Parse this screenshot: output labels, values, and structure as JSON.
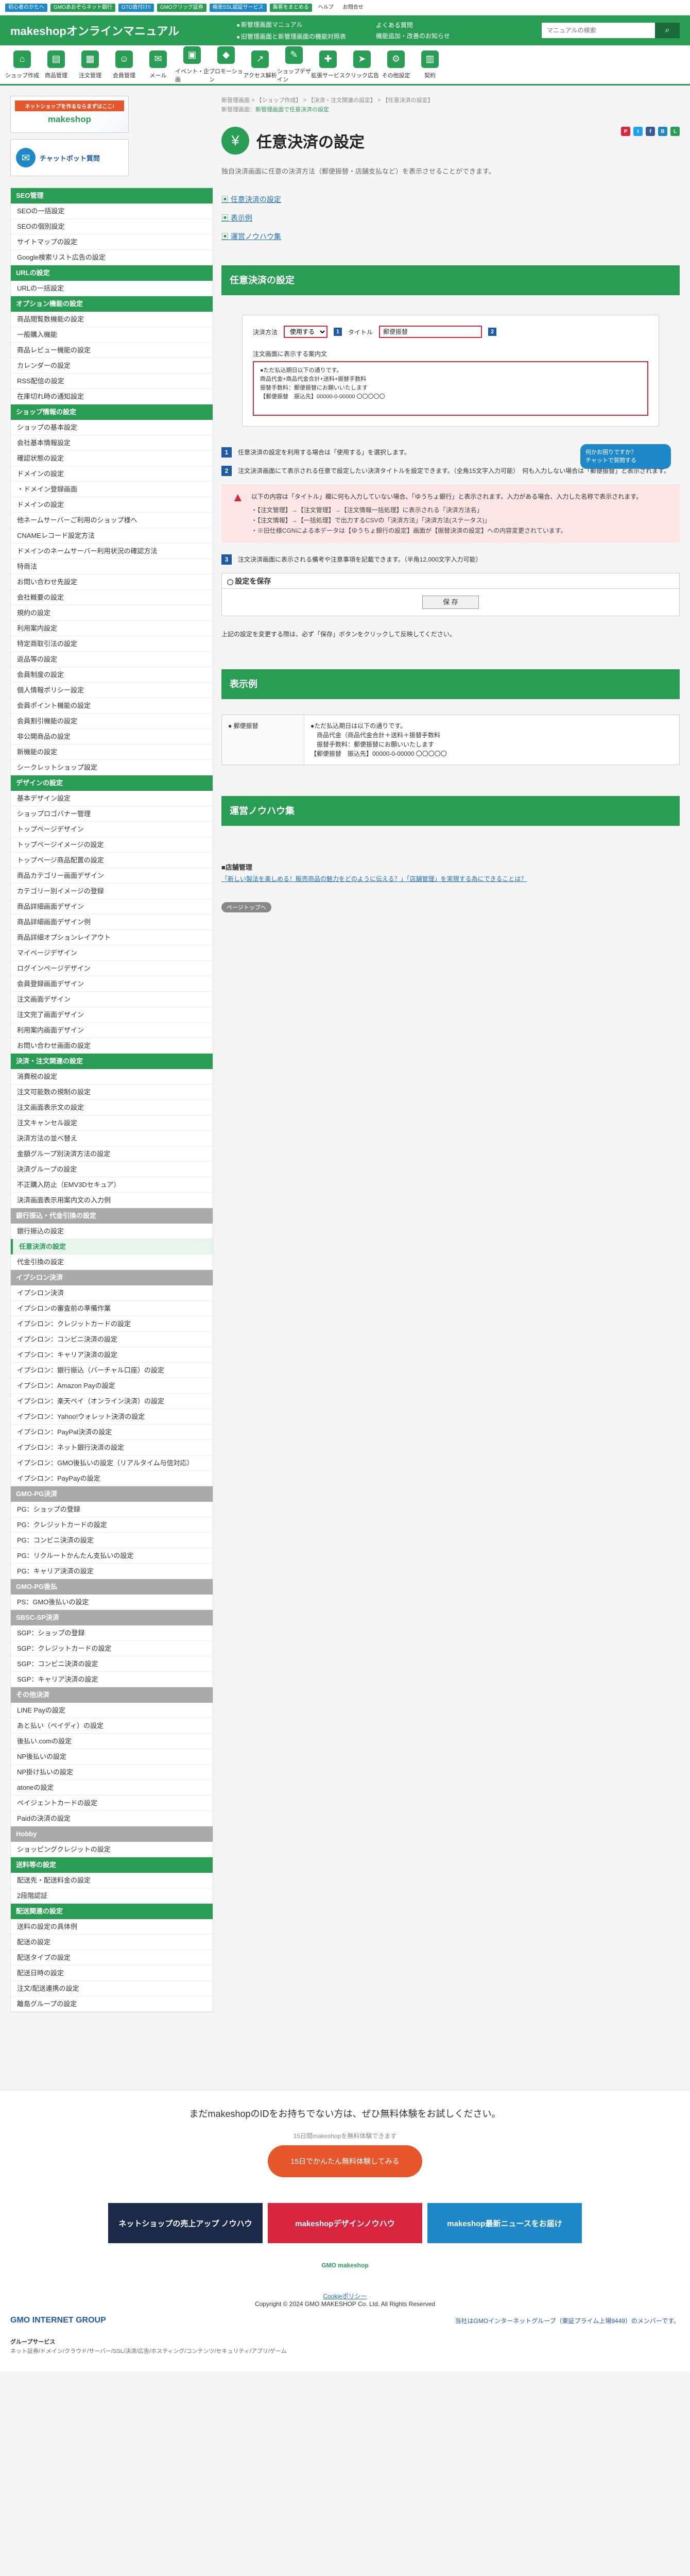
{
  "topbar": {
    "links": [
      "初心者のかたへ",
      "GMOあおぞらネット銀行",
      "GTO直付け!!",
      "GMOクリック証券",
      "格安SSL認証サービス",
      "集客をまとめる",
      "ヘルプ",
      "お問合せ"
    ]
  },
  "header": {
    "logo": "makeshopオンラインマニュアル",
    "links": [
      "新管理画面マニュアル",
      "旧管理画面と新管理画面の機能対照表"
    ],
    "faq_label": "よくある質問",
    "news_label": "機能追加・改善のお知らせ",
    "search_placeholder": "マニュアルの検索"
  },
  "nav": {
    "items": [
      {
        "label": "ショップ作成",
        "icon": "shop-icon"
      },
      {
        "label": "商品管理",
        "icon": "box-icon"
      },
      {
        "label": "注文管理",
        "icon": "clipboard-icon"
      },
      {
        "label": "会員管理",
        "icon": "users-icon"
      },
      {
        "label": "メール",
        "icon": "mail-icon"
      },
      {
        "label": "イベント・企画",
        "icon": "calendar-icon"
      },
      {
        "label": "プロモーション",
        "icon": "megaphone-icon"
      },
      {
        "label": "アクセス解析",
        "icon": "chart-icon"
      },
      {
        "label": "ショップデザイン",
        "icon": "palette-icon"
      },
      {
        "label": "拡張サービス",
        "icon": "puzzle-icon"
      },
      {
        "label": "クリック広告",
        "icon": "cursor-icon"
      },
      {
        "label": "その他設定",
        "icon": "gear-icon"
      },
      {
        "label": "契約",
        "icon": "document-icon"
      }
    ]
  },
  "banners": {
    "b1_top": "ネットショップを作るならまずはここ!",
    "b1_brand": "makeshop",
    "b2": "チャットボット質問"
  },
  "sidebar": {
    "groups": [
      {
        "title": "SEO管理",
        "items": [
          "SEOの一括設定",
          "SEOの個別設定",
          "サイトマップの設定",
          "Google検索リスト広告の設定"
        ]
      },
      {
        "title": "URLの設定",
        "items": [
          "URLの一括設定"
        ]
      },
      {
        "title": "オプション機能の設定",
        "items": [
          "商品閲覧数機能の設定",
          "一般購入機能",
          "商品レビュー機能の設定",
          "カレンダーの設定",
          "RSS配信の設定",
          "在庫切れ時の通知設定"
        ]
      },
      {
        "title": "ショップ情報の設定",
        "items": [
          "ショップの基本設定",
          "会社基本情報設定",
          "確認状態の設定",
          "ドメインの設定",
          "・ドメイン登録画面",
          "ドメインの設定",
          "他ネームサーバーご利用のショップ様へ",
          "CNAMEレコード設定方法",
          "ドメインのネームサーバー利用状況の確認方法",
          "特商法",
          "お問い合わせ先設定",
          "会社概要の設定",
          "規約の設定",
          "利用案内設定",
          "特定商取引法の設定",
          "返品等の設定",
          "会員制度の設定",
          "個人情報ポリシー設定",
          "会員ポイント機能の設定",
          "会員割引機能の設定",
          "非公開商品の設定",
          "新機能の設定",
          "シークレットショップ設定"
        ]
      },
      {
        "title": "デザインの設定",
        "items": [
          "基本デザイン設定",
          "ショップロゴバナー管理",
          "トップページデザイン",
          "トップページイメージの設定",
          "トップページ商品配置の設定",
          "商品カテゴリー画面デザイン",
          "カテゴリー別イメージの登録",
          "商品詳細画面デザイン",
          "商品詳細画面デザイン例",
          "商品詳細オプションレイアウト",
          "マイページデザイン",
          "ログインページデザイン",
          "会員登録画面デザイン",
          "注文画面デザイン",
          "注文完了画面デザイン",
          "利用案内画面デザイン",
          "お問い合わせ画面の設定"
        ]
      },
      {
        "title": "決済・注文関連の設定",
        "items": [
          "消費税の設定",
          "注文可能数の規制の設定",
          "注文画面表示文の設定",
          "注文キャンセル設定",
          "決済方法の並べ替え",
          "金額グループ別決済方法の設定",
          "決済グループの設定",
          "不正購入防止（EMV3Dセキュア）",
          "決済画面表示用案内文の入力例"
        ]
      },
      {
        "title": "銀行振込・代金引換の設定",
        "gray": true,
        "items": [
          "銀行振込の設定",
          "任意決済の設定",
          "代金引換の設定"
        ]
      },
      {
        "title": "イプシロン決済",
        "gray": true,
        "items": [
          "イプシロン決済",
          "イプシロンの審査前の準備作業",
          "イプシロン：クレジットカードの設定",
          "イプシロン：コンビニ決済の設定",
          "イプシロン：キャリア決済の設定",
          "イプシロン：銀行振込（バーチャル口座）の設定",
          "イプシロン：Amazon Payの設定",
          "イプシロン：楽天ペイ（オンライン決済）の設定",
          "イプシロン：Yahoo!ウォレット決済の設定",
          "イプシロン：PayPal決済の設定",
          "イプシロン：ネット銀行決済の設定",
          "イプシロン：GMO後払いの設定（リアルタイム与信対応）",
          "イプシロン：PayPayの設定"
        ]
      },
      {
        "title": "GMO-PG決済",
        "gray": true,
        "items": [
          "PG：ショップの登録",
          "PG：クレジットカードの設定",
          "PG：コンビニ決済の設定",
          "PG：リクルートかんたん支払いの設定",
          "PG：キャリア決済の設定"
        ]
      },
      {
        "title": "GMO-PG後払",
        "gray": true,
        "items": [
          "PS：GMO後払いの設定"
        ]
      },
      {
        "title": "SBSC-SP決済",
        "gray": true,
        "items": [
          "SGP：ショップの登録",
          "SGP：クレジットカードの設定",
          "SGP：コンビニ決済の設定",
          "SGP：キャリア決済の設定"
        ]
      },
      {
        "title": "その他決済",
        "gray": true,
        "items": [
          "LINE Payの設定",
          "あと払い（ペイディ）の設定",
          "後払い.comの設定",
          "NP後払いの設定",
          "NP掛け払いの設定",
          "atoneの設定",
          "ペイジェントカードの設定",
          "Paidの決済の設定"
        ]
      },
      {
        "title": "Hobby",
        "gray": true,
        "items": [
          "ショッピングクレジットの設定"
        ]
      },
      {
        "title": "送料等の設定",
        "items": [
          "配送先・配送料金の設定",
          "2段階認証"
        ]
      },
      {
        "title": "配送関連の設定",
        "items": [
          "送料の設定の具体例",
          "配送の設定",
          "配送タイプの設定",
          "配送日時の設定",
          "注文/配送連携の設定",
          "離島グループの設定"
        ]
      }
    ],
    "active_item": "任意決済の設定"
  },
  "breadcrumb": {
    "line1": "新管理画面 > 【ショップ作成】 > 【決済・注文関連の設定】 > 【任意決済の設定】",
    "line2_prefix": "新管理画面：",
    "line2_link": "新管理画面で任意決済の設定"
  },
  "page": {
    "title": "任意決済の設定",
    "lead": "独自決済画面に任意の決済方法（郵便振替・店舗支払など）を表示させることができます。",
    "toc": [
      "任意決済の設定",
      "表示例",
      "運営ノウハウ集"
    ]
  },
  "section1": {
    "title": "任意決済の設定",
    "form": {
      "use_label": "決済方法",
      "use_value": "使用する",
      "title_label": "タイトル",
      "title_value": "郵便振替",
      "body_label": "注文画面に表示する案内文",
      "body_lines": [
        "●ただ払込期日以下の通りです。",
        "商品代金+商品代金合計+送料+振替手数料",
        "振替手数料：郵便振替にお願いいたします",
        "",
        "【郵便振替　振込先】00000-0-00000 〇〇〇〇〇"
      ]
    },
    "chat": {
      "line1": "何かお困りですか？",
      "line2": "チャットで質問する"
    },
    "steps": [
      {
        "num": "1",
        "text": "任意決済の設定を利用する場合は「使用する」を選択します。"
      },
      {
        "num": "2",
        "text": "注文決済画面にて表示される任意で設定したい決済タイトルを設定できます。（全角15文字入力可能）　何も入力しない場合は「郵便振替」と表示されます。"
      },
      {
        "num": "3",
        "text": "注文決済画面に表示される備考や注意事項を記載できます。（半角12,000文字入力可能）"
      }
    ],
    "warning": {
      "text": "以下の内容は「タイトル」欄に何も入力していない場合、「ゆうちょ銀行」と表示されます。入力がある場合、入力した名称で表示されます。",
      "items": [
        "【注文管理】→【注文管理】→【注文情報一括処理】に表示される「決済方法名」",
        "【注文情報】→【一括処理】で出力するCSVの「決済方法」「決済方法(ステータス)」",
        "※旧仕様CGNによる本データは【ゆうちょ銀行の設定】画面が【振替決済の設定】への内容変更されています。"
      ]
    },
    "save": {
      "heading": "設定を保存",
      "button": "保 存",
      "note": "上記の設定を変更する際は、必ず「保存」ボタンをクリックして反映してください。"
    }
  },
  "section2": {
    "title": "表示例",
    "label": "● 郵便振替",
    "lines": [
      "●ただ払込期日は以下の通りです。",
      "　商品代金（商品代金合計＋送料＋振替手数料",
      "　振替手数料：郵便振替にお願いいたします",
      "",
      "【郵便振替　振込先】00000-0-00000 〇〇〇〇〇"
    ]
  },
  "section3": {
    "title": "運営ノウハウ集",
    "subtitle": "■店舗管理",
    "link": "「新しい製法を楽しめる！販売商品の魅力をどのように伝える？」「店舗管理」を実現する為にできることは？"
  },
  "back_button": "ページトップへ",
  "footer": {
    "cta": "まだmakeshopのIDをお持ちでない方は、ぜひ無料体験をお試しください。",
    "cta_sub": "15日間makeshopを無料体験できます",
    "cta_button": "15日でかんたん無料体験してみる",
    "banners": [
      "ネットショップの売上アップ ノウハウ",
      "makeshopデザインノウハウ",
      "makeshop最新ニュースをお届け"
    ],
    "logo": "GMO makeshop",
    "cookie": "Cookieポリシー",
    "copyright": "Copyright © 2024 GMO MAKESHOP Co. Ltd. All Rights Reserved",
    "group": "GMO INTERNET GROUP",
    "group_text": "当社はGMOインターネットグループ（東証プライム上場9449）のメンバーです。",
    "services_title": "グループサービス",
    "services": "ネット証券/ドメイン/クラウド/サーバー/SSL/決済/広告/ホスティング/コンテンツ/セキュリティ/アプリ/ゲーム"
  },
  "colors": {
    "brand": "#2a9d55",
    "accent": "#e8572c",
    "link": "#1e6fb8",
    "marker": "#1e5aa8",
    "alert": "#d7263d"
  }
}
